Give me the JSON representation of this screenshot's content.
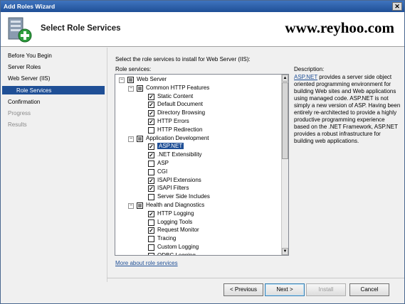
{
  "window": {
    "title": "Add Roles Wizard",
    "close_glyph": "✕"
  },
  "header": {
    "title": "Select Role Services",
    "watermark": "www.reyhoo.com",
    "icon": "server-roles-icon"
  },
  "nav": {
    "items": [
      {
        "label": "Before You Begin",
        "state": "normal"
      },
      {
        "label": "Server Roles",
        "state": "normal"
      },
      {
        "label": "Web Server (IIS)",
        "state": "normal"
      },
      {
        "label": "Role Services",
        "state": "selected"
      },
      {
        "label": "Confirmation",
        "state": "normal"
      },
      {
        "label": "Progress",
        "state": "disabled"
      },
      {
        "label": "Results",
        "state": "disabled"
      }
    ]
  },
  "main": {
    "instruction": "Select the role services to install for Web Server (IIS):",
    "services_label": "Role services:",
    "description_label": "Description:",
    "tree": [
      {
        "label": "Web Server",
        "level": 0,
        "expand": "−",
        "check": "partial"
      },
      {
        "label": "Common HTTP Features",
        "level": 1,
        "expand": "−",
        "check": "partial"
      },
      {
        "label": "Static Content",
        "level": 2,
        "check": "checked"
      },
      {
        "label": "Default Document",
        "level": 2,
        "check": "checked"
      },
      {
        "label": "Directory Browsing",
        "level": 2,
        "check": "checked"
      },
      {
        "label": "HTTP Errors",
        "level": 2,
        "check": "checked"
      },
      {
        "label": "HTTP Redirection",
        "level": 2,
        "check": "unchecked"
      },
      {
        "label": "Application Development",
        "level": 1,
        "expand": "−",
        "check": "partial"
      },
      {
        "label": "ASP.NET",
        "level": 2,
        "check": "checked",
        "selected": true
      },
      {
        "label": ".NET Extensibility",
        "level": 2,
        "check": "checked"
      },
      {
        "label": "ASP",
        "level": 2,
        "check": "unchecked"
      },
      {
        "label": "CGI",
        "level": 2,
        "check": "unchecked"
      },
      {
        "label": "ISAPI Extensions",
        "level": 2,
        "check": "checked"
      },
      {
        "label": "ISAPI Filters",
        "level": 2,
        "check": "checked"
      },
      {
        "label": "Server Side Includes",
        "level": 2,
        "check": "unchecked"
      },
      {
        "label": "Health and Diagnostics",
        "level": 1,
        "expand": "−",
        "check": "partial"
      },
      {
        "label": "HTTP Logging",
        "level": 2,
        "check": "checked"
      },
      {
        "label": "Logging Tools",
        "level": 2,
        "check": "unchecked"
      },
      {
        "label": "Request Monitor",
        "level": 2,
        "check": "checked"
      },
      {
        "label": "Tracing",
        "level": 2,
        "check": "unchecked"
      },
      {
        "label": "Custom Logging",
        "level": 2,
        "check": "unchecked"
      },
      {
        "label": "ODBC Logging",
        "level": 2,
        "check": "unchecked"
      }
    ],
    "description_link": "ASP.NET",
    "description_text": " provides a server side object oriented programming environment for building Web sites and Web applications using managed code. ASP.NET is not simply a new version of ASP. Having been entirely re-architected to provide a highly productive programming experience based on the .NET Framework, ASP.NET provides a robust infrastructure for building web applications.",
    "more_link": "More about role services"
  },
  "footer": {
    "previous": "< Previous",
    "next": "Next >",
    "install": "Install",
    "cancel": "Cancel"
  },
  "colors": {
    "accent": "#1f4f96",
    "link": "#1f4f96",
    "titlebar": "#2d5faa"
  }
}
